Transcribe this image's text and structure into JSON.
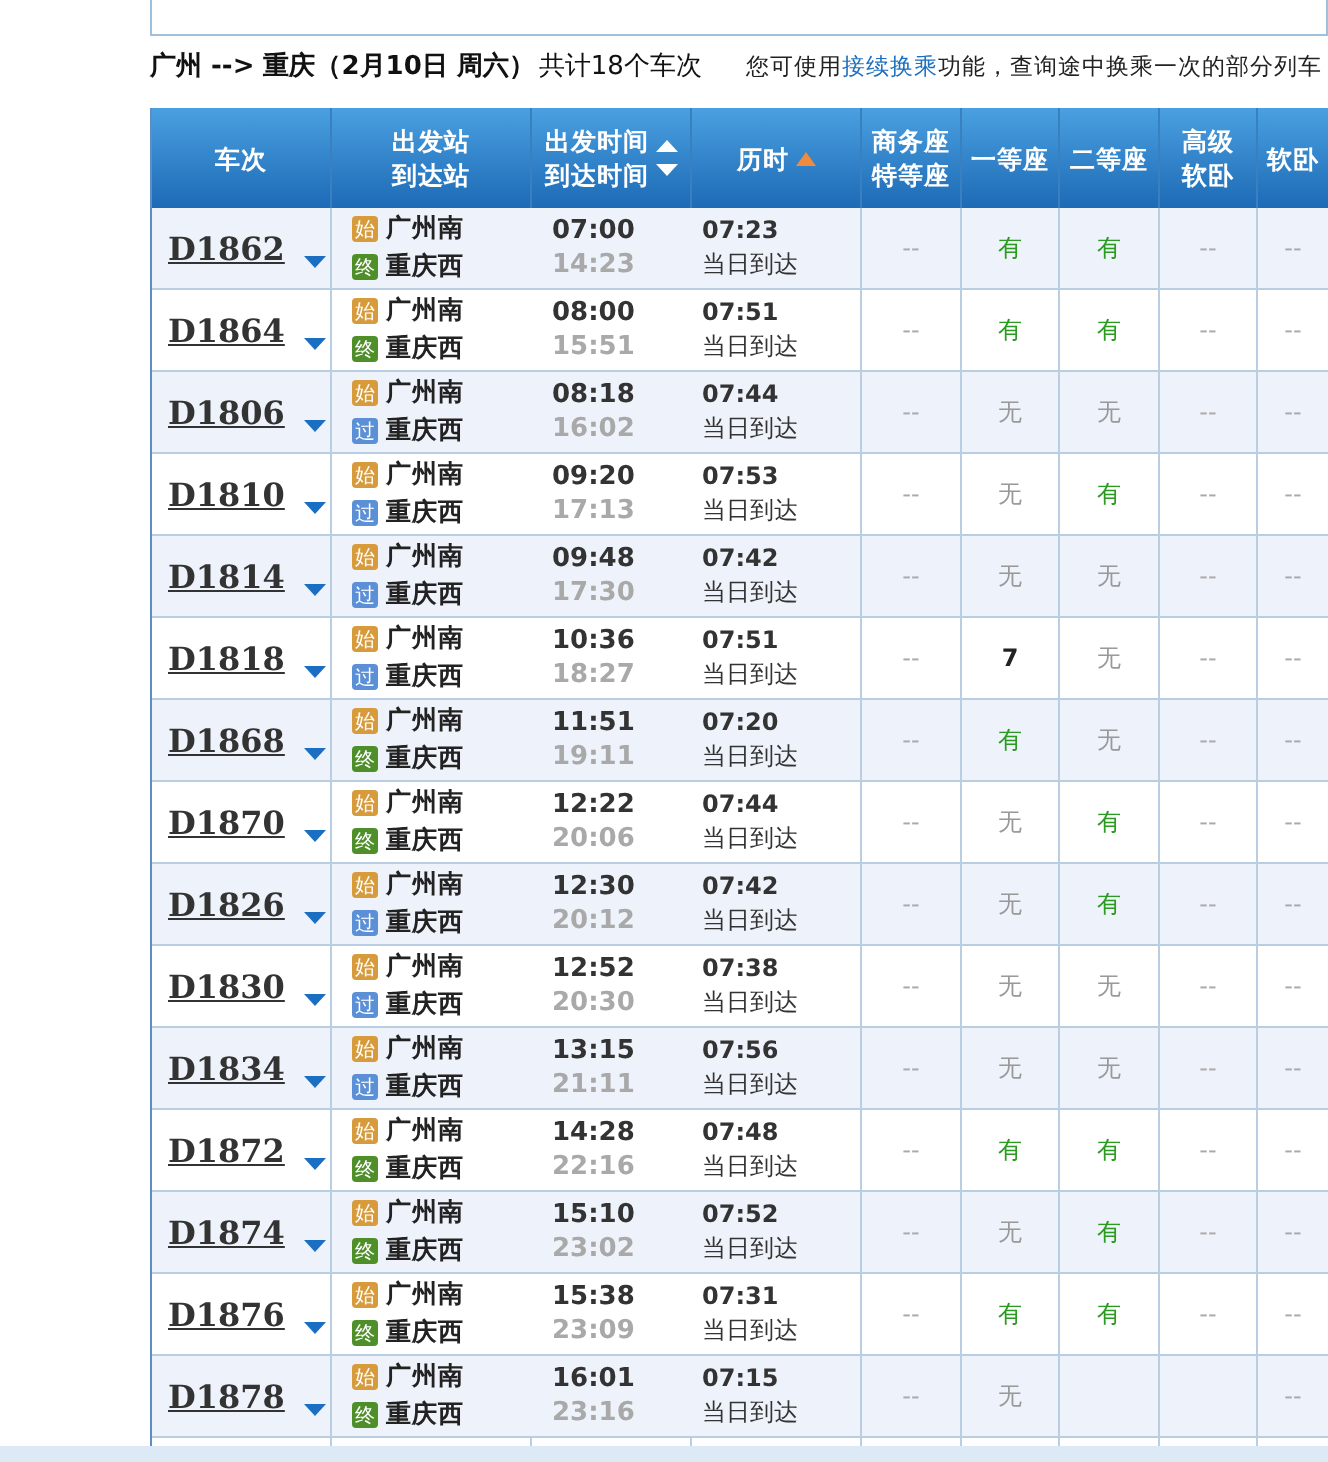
{
  "title": {
    "route": "广州 --> 重庆（2月10日  周六）",
    "count": "共计18个车次"
  },
  "notice": {
    "before": "您可使用",
    "link": "接续换乘",
    "after": "功能，查询途中换乘一次的部分列车"
  },
  "columns": [
    {
      "lines": [
        "车次"
      ],
      "sort_arrows": false,
      "sorted": false
    },
    {
      "lines": [
        "出发站",
        "到达站"
      ],
      "sort_arrows": false,
      "sorted": false
    },
    {
      "lines": [
        "出发时间",
        "到达时间"
      ],
      "sort_arrows": true,
      "sorted": false
    },
    {
      "lines": [
        "历时"
      ],
      "sort_arrows": false,
      "sorted": true
    },
    {
      "lines": [
        "商务座",
        "特等座"
      ],
      "sort_arrows": false,
      "sorted": false
    },
    {
      "lines": [
        "一等座"
      ],
      "sort_arrows": false,
      "sorted": false
    },
    {
      "lines": [
        "二等座"
      ],
      "sort_arrows": false,
      "sorted": false
    },
    {
      "lines": [
        "高级",
        "软卧"
      ],
      "sort_arrows": false,
      "sorted": false
    },
    {
      "lines": [
        "软卧"
      ],
      "sort_arrows": false,
      "sorted": false
    }
  ],
  "rows": [
    {
      "train": "D1862",
      "from": {
        "tag": "始",
        "kind": "start",
        "name": "广州南"
      },
      "to": {
        "tag": "终",
        "kind": "end",
        "name": "重庆西"
      },
      "dep": "07:00",
      "arr": "14:23",
      "duration": "07:23",
      "arrival_day": "当日到达",
      "business": {
        "text": "--",
        "kind": "na"
      },
      "first": {
        "text": "有",
        "kind": "yes"
      },
      "second": {
        "text": "有",
        "kind": "yes"
      },
      "deluxe_soft": {
        "text": "--",
        "kind": "na"
      },
      "soft": {
        "text": "--",
        "kind": "na"
      }
    },
    {
      "train": "D1864",
      "from": {
        "tag": "始",
        "kind": "start",
        "name": "广州南"
      },
      "to": {
        "tag": "终",
        "kind": "end",
        "name": "重庆西"
      },
      "dep": "08:00",
      "arr": "15:51",
      "duration": "07:51",
      "arrival_day": "当日到达",
      "business": {
        "text": "--",
        "kind": "na"
      },
      "first": {
        "text": "有",
        "kind": "yes"
      },
      "second": {
        "text": "有",
        "kind": "yes"
      },
      "deluxe_soft": {
        "text": "--",
        "kind": "na"
      },
      "soft": {
        "text": "--",
        "kind": "na"
      }
    },
    {
      "train": "D1806",
      "from": {
        "tag": "始",
        "kind": "start",
        "name": "广州南"
      },
      "to": {
        "tag": "过",
        "kind": "pass",
        "name": "重庆西"
      },
      "dep": "08:18",
      "arr": "16:02",
      "duration": "07:44",
      "arrival_day": "当日到达",
      "business": {
        "text": "--",
        "kind": "na"
      },
      "first": {
        "text": "无",
        "kind": "no"
      },
      "second": {
        "text": "无",
        "kind": "no"
      },
      "deluxe_soft": {
        "text": "--",
        "kind": "na"
      },
      "soft": {
        "text": "--",
        "kind": "na"
      }
    },
    {
      "train": "D1810",
      "from": {
        "tag": "始",
        "kind": "start",
        "name": "广州南"
      },
      "to": {
        "tag": "过",
        "kind": "pass",
        "name": "重庆西"
      },
      "dep": "09:20",
      "arr": "17:13",
      "duration": "07:53",
      "arrival_day": "当日到达",
      "business": {
        "text": "--",
        "kind": "na"
      },
      "first": {
        "text": "无",
        "kind": "no"
      },
      "second": {
        "text": "有",
        "kind": "yes"
      },
      "deluxe_soft": {
        "text": "--",
        "kind": "na"
      },
      "soft": {
        "text": "--",
        "kind": "na"
      }
    },
    {
      "train": "D1814",
      "from": {
        "tag": "始",
        "kind": "start",
        "name": "广州南"
      },
      "to": {
        "tag": "过",
        "kind": "pass",
        "name": "重庆西"
      },
      "dep": "09:48",
      "arr": "17:30",
      "duration": "07:42",
      "arrival_day": "当日到达",
      "business": {
        "text": "--",
        "kind": "na"
      },
      "first": {
        "text": "无",
        "kind": "no"
      },
      "second": {
        "text": "无",
        "kind": "no"
      },
      "deluxe_soft": {
        "text": "--",
        "kind": "na"
      },
      "soft": {
        "text": "--",
        "kind": "na"
      }
    },
    {
      "train": "D1818",
      "from": {
        "tag": "始",
        "kind": "start",
        "name": "广州南"
      },
      "to": {
        "tag": "过",
        "kind": "pass",
        "name": "重庆西"
      },
      "dep": "10:36",
      "arr": "18:27",
      "duration": "07:51",
      "arrival_day": "当日到达",
      "business": {
        "text": "--",
        "kind": "na"
      },
      "first": {
        "text": "7",
        "kind": "count"
      },
      "second": {
        "text": "无",
        "kind": "no"
      },
      "deluxe_soft": {
        "text": "--",
        "kind": "na"
      },
      "soft": {
        "text": "--",
        "kind": "na"
      }
    },
    {
      "train": "D1868",
      "from": {
        "tag": "始",
        "kind": "start",
        "name": "广州南"
      },
      "to": {
        "tag": "终",
        "kind": "end",
        "name": "重庆西"
      },
      "dep": "11:51",
      "arr": "19:11",
      "duration": "07:20",
      "arrival_day": "当日到达",
      "business": {
        "text": "--",
        "kind": "na"
      },
      "first": {
        "text": "有",
        "kind": "yes"
      },
      "second": {
        "text": "无",
        "kind": "no"
      },
      "deluxe_soft": {
        "text": "--",
        "kind": "na"
      },
      "soft": {
        "text": "--",
        "kind": "na"
      }
    },
    {
      "train": "D1870",
      "from": {
        "tag": "始",
        "kind": "start",
        "name": "广州南"
      },
      "to": {
        "tag": "终",
        "kind": "end",
        "name": "重庆西"
      },
      "dep": "12:22",
      "arr": "20:06",
      "duration": "07:44",
      "arrival_day": "当日到达",
      "business": {
        "text": "--",
        "kind": "na"
      },
      "first": {
        "text": "无",
        "kind": "no"
      },
      "second": {
        "text": "有",
        "kind": "yes"
      },
      "deluxe_soft": {
        "text": "--",
        "kind": "na"
      },
      "soft": {
        "text": "--",
        "kind": "na"
      }
    },
    {
      "train": "D1826",
      "from": {
        "tag": "始",
        "kind": "start",
        "name": "广州南"
      },
      "to": {
        "tag": "过",
        "kind": "pass",
        "name": "重庆西"
      },
      "dep": "12:30",
      "arr": "20:12",
      "duration": "07:42",
      "arrival_day": "当日到达",
      "business": {
        "text": "--",
        "kind": "na"
      },
      "first": {
        "text": "无",
        "kind": "no"
      },
      "second": {
        "text": "有",
        "kind": "yes"
      },
      "deluxe_soft": {
        "text": "--",
        "kind": "na"
      },
      "soft": {
        "text": "--",
        "kind": "na"
      }
    },
    {
      "train": "D1830",
      "from": {
        "tag": "始",
        "kind": "start",
        "name": "广州南"
      },
      "to": {
        "tag": "过",
        "kind": "pass",
        "name": "重庆西"
      },
      "dep": "12:52",
      "arr": "20:30",
      "duration": "07:38",
      "arrival_day": "当日到达",
      "business": {
        "text": "--",
        "kind": "na"
      },
      "first": {
        "text": "无",
        "kind": "no"
      },
      "second": {
        "text": "无",
        "kind": "no"
      },
      "deluxe_soft": {
        "text": "--",
        "kind": "na"
      },
      "soft": {
        "text": "--",
        "kind": "na"
      }
    },
    {
      "train": "D1834",
      "from": {
        "tag": "始",
        "kind": "start",
        "name": "广州南"
      },
      "to": {
        "tag": "过",
        "kind": "pass",
        "name": "重庆西"
      },
      "dep": "13:15",
      "arr": "21:11",
      "duration": "07:56",
      "arrival_day": "当日到达",
      "business": {
        "text": "--",
        "kind": "na"
      },
      "first": {
        "text": "无",
        "kind": "no"
      },
      "second": {
        "text": "无",
        "kind": "no"
      },
      "deluxe_soft": {
        "text": "--",
        "kind": "na"
      },
      "soft": {
        "text": "--",
        "kind": "na"
      }
    },
    {
      "train": "D1872",
      "from": {
        "tag": "始",
        "kind": "start",
        "name": "广州南"
      },
      "to": {
        "tag": "终",
        "kind": "end",
        "name": "重庆西"
      },
      "dep": "14:28",
      "arr": "22:16",
      "duration": "07:48",
      "arrival_day": "当日到达",
      "business": {
        "text": "--",
        "kind": "na"
      },
      "first": {
        "text": "有",
        "kind": "yes"
      },
      "second": {
        "text": "有",
        "kind": "yes"
      },
      "deluxe_soft": {
        "text": "--",
        "kind": "na"
      },
      "soft": {
        "text": "--",
        "kind": "na"
      }
    },
    {
      "train": "D1874",
      "from": {
        "tag": "始",
        "kind": "start",
        "name": "广州南"
      },
      "to": {
        "tag": "终",
        "kind": "end",
        "name": "重庆西"
      },
      "dep": "15:10",
      "arr": "23:02",
      "duration": "07:52",
      "arrival_day": "当日到达",
      "business": {
        "text": "--",
        "kind": "na"
      },
      "first": {
        "text": "无",
        "kind": "no"
      },
      "second": {
        "text": "有",
        "kind": "yes"
      },
      "deluxe_soft": {
        "text": "--",
        "kind": "na"
      },
      "soft": {
        "text": "--",
        "kind": "na"
      }
    },
    {
      "train": "D1876",
      "from": {
        "tag": "始",
        "kind": "start",
        "name": "广州南"
      },
      "to": {
        "tag": "终",
        "kind": "end",
        "name": "重庆西"
      },
      "dep": "15:38",
      "arr": "23:09",
      "duration": "07:31",
      "arrival_day": "当日到达",
      "business": {
        "text": "--",
        "kind": "na"
      },
      "first": {
        "text": "有",
        "kind": "yes"
      },
      "second": {
        "text": "有",
        "kind": "yes"
      },
      "deluxe_soft": {
        "text": "--",
        "kind": "na"
      },
      "soft": {
        "text": "--",
        "kind": "na"
      }
    },
    {
      "train": "D1878",
      "from": {
        "tag": "始",
        "kind": "start",
        "name": "广州南"
      },
      "to": {
        "tag": "终",
        "kind": "end",
        "name": "重庆西"
      },
      "dep": "16:01",
      "arr": "23:16",
      "duration": "07:15",
      "arrival_day": "当日到达",
      "business": {
        "text": "--",
        "kind": "na"
      },
      "first": {
        "text": "无",
        "kind": "no"
      },
      "soft": {
        "text": "--",
        "kind": "na"
      }
    }
  ]
}
